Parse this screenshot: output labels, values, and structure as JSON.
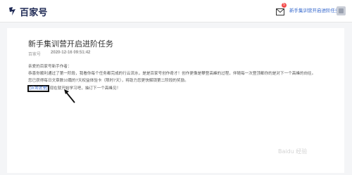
{
  "header": {
    "logo_text": "百家号",
    "notification_badge": "5",
    "notification_text": "新手集训营开启进阶任务"
  },
  "article": {
    "title": "新手集训营开启进阶任务",
    "source": "百家号",
    "date": "2020-12-16 09:51:42",
    "greeting": "亲爱的百家号新手作者：",
    "line1": "恭喜你顺利通过了第一阶段，我看你每个任务都完成的行云流水，是是百家号创作奇才！创作更像是攀登高峰的过程，伴随每一次登顶都你的是对下一个高峰的向往。",
    "line2": "您已获得每日文章数10篇的7天权益体验卡（限时7天），将助力您更快解锁第二阶段的奖励。",
    "link_text": "[点击这里]",
    "link_suffix": "现在就开始学习吧，抽订下一个高峰见！"
  },
  "watermark": "Baidu 经验"
}
